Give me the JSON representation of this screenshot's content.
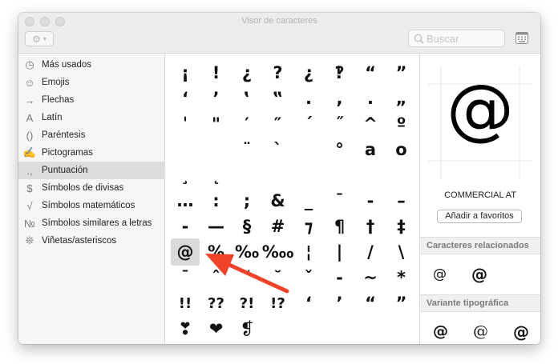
{
  "window": {
    "title": "Visor de caracteres"
  },
  "toolbar": {
    "search_placeholder": "Buscar"
  },
  "sidebar": {
    "items": [
      {
        "icon": "clock-icon",
        "glyph": "◷",
        "label": "Más usados"
      },
      {
        "icon": "emoji-icon",
        "glyph": "☺",
        "label": "Emojis"
      },
      {
        "icon": "arrow-icon",
        "glyph": "→",
        "label": "Flechas"
      },
      {
        "icon": "latin-icon",
        "glyph": "A",
        "label": "Latín"
      },
      {
        "icon": "parentheses-icon",
        "glyph": "()",
        "label": "Paréntesis"
      },
      {
        "icon": "pictogram-icon",
        "glyph": "✍",
        "label": "Pictogramas"
      },
      {
        "icon": "punctuation-icon",
        "glyph": ".,",
        "label": "Puntuación"
      },
      {
        "icon": "currency-icon",
        "glyph": "$",
        "label": "Símbolos de divisas"
      },
      {
        "icon": "math-icon",
        "glyph": "√",
        "label": "Símbolos matemáticos"
      },
      {
        "icon": "letterlike-icon",
        "glyph": "№",
        "label": "Símbolos similares a letras"
      },
      {
        "icon": "asterisk-icon",
        "glyph": "❊",
        "label": "Viñetas/asteriscos"
      }
    ],
    "selected": "Puntuación"
  },
  "grid": {
    "rows": [
      [
        "¡",
        "!",
        "¿",
        "?",
        "¿",
        "‽",
        "“",
        "”"
      ],
      [
        "‘",
        "’",
        "‛",
        "‟",
        ".",
        ",",
        ".",
        "„"
      ],
      [
        "ˈ",
        "\"",
        "′",
        "″",
        "ˊ",
        "˝",
        "^",
        "º"
      ],
      [
        "",
        "",
        "¨",
        "`",
        "",
        "°",
        "a",
        "o"
      ],
      [
        "¸",
        "˛",
        "",
        "",
        "",
        "",
        "",
        ""
      ],
      [
        "…",
        ":",
        ";",
        "&",
        "_",
        "¯",
        "-",
        "–"
      ],
      [
        "-",
        "—",
        "§",
        "#",
        "⁊",
        "¶",
        "†",
        "‡"
      ],
      [
        "@",
        "%",
        "‰",
        "‱",
        "¦",
        "|",
        "/",
        "\\"
      ],
      [
        "ˉ",
        "ˆ",
        "˘",
        "˘",
        "ˇ",
        "-",
        "~",
        "*"
      ],
      [
        "!!",
        "??",
        "?!",
        "!?",
        "‘",
        "’",
        "“",
        "”"
      ],
      [
        "❣",
        "❤",
        "❡",
        "",
        "",
        "",
        "",
        ""
      ]
    ],
    "selected": "@"
  },
  "detail": {
    "preview_char": "@",
    "char_name": "COMMERCIAL AT",
    "favorites_button": "Añadir a favoritos",
    "related_heading": "Caracteres relacionados",
    "related": [
      "@",
      "@"
    ],
    "variant_heading": "Variante tipográfica",
    "variants": [
      "@",
      "@",
      "@"
    ]
  },
  "colors": {
    "annotation_arrow": "#f0432a",
    "selection": "#d9d9d9"
  }
}
